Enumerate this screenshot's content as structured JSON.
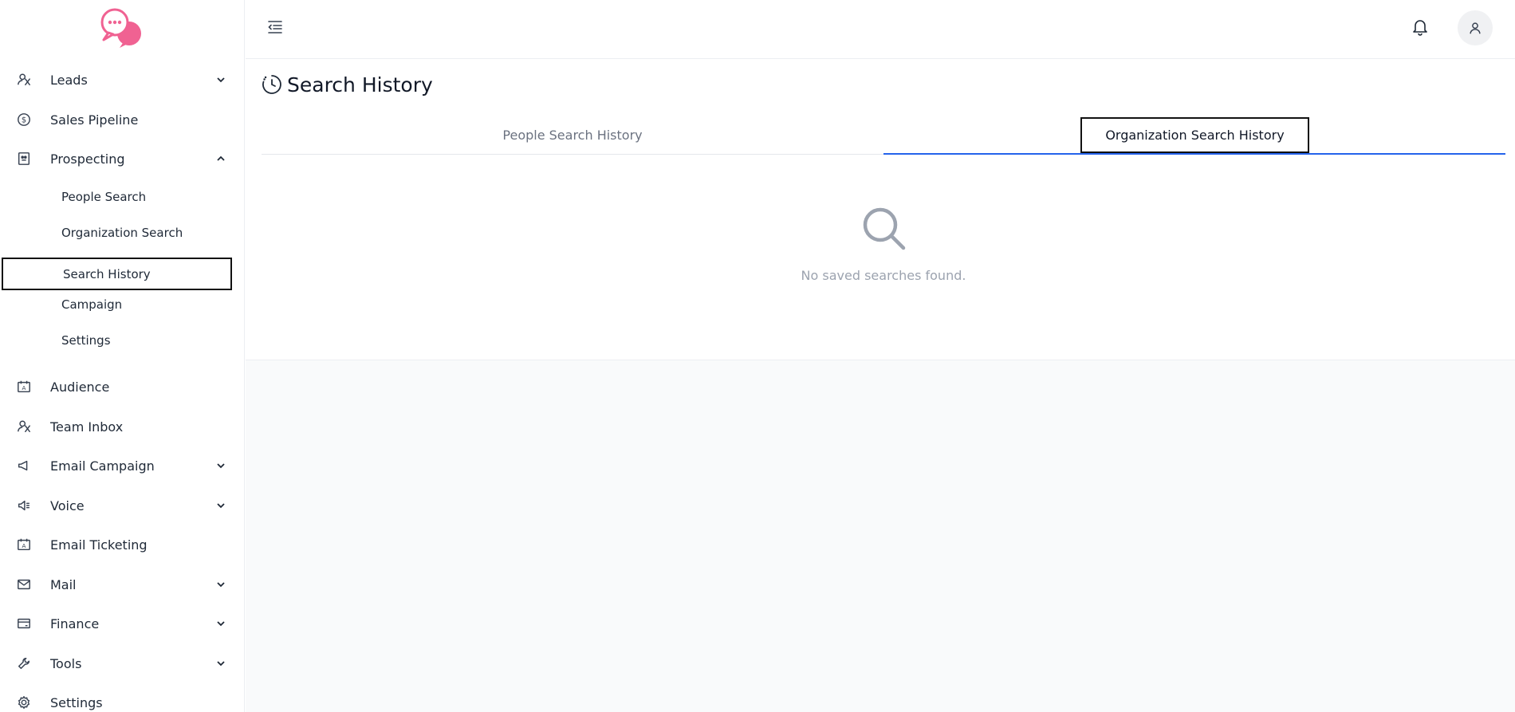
{
  "sidebar": {
    "items": [
      {
        "label": "Leads",
        "icon": "leads-icon",
        "has_chevron": true,
        "chevron": "down"
      },
      {
        "label": "Sales Pipeline",
        "icon": "dollar-icon"
      },
      {
        "label": "Prospecting",
        "icon": "prospecting-icon",
        "has_chevron": true,
        "chevron": "up"
      },
      {
        "label": "Audience",
        "icon": "audience-icon"
      },
      {
        "label": "Team Inbox",
        "icon": "team-inbox-icon"
      },
      {
        "label": "Email Campaign",
        "icon": "megaphone-icon",
        "has_chevron": true,
        "chevron": "down"
      },
      {
        "label": "Voice",
        "icon": "speaker-icon",
        "has_chevron": true,
        "chevron": "down"
      },
      {
        "label": "Email Ticketing",
        "icon": "ticket-icon"
      },
      {
        "label": "Mail",
        "icon": "mail-icon",
        "has_chevron": true,
        "chevron": "down"
      },
      {
        "label": "Finance",
        "icon": "card-icon",
        "has_chevron": true,
        "chevron": "down"
      },
      {
        "label": "Tools",
        "icon": "wrench-icon",
        "has_chevron": true,
        "chevron": "down"
      },
      {
        "label": "Settings",
        "icon": "gear-icon"
      }
    ],
    "prospecting_sub": [
      {
        "label": "People Search"
      },
      {
        "label": "Organization Search"
      },
      {
        "label": "Search History",
        "active": true
      },
      {
        "label": "Campaign"
      },
      {
        "label": "Settings"
      }
    ]
  },
  "main": {
    "title": "Search History",
    "tabs": [
      {
        "label": "People Search History",
        "active": false
      },
      {
        "label": "Organization Search History",
        "active": true
      }
    ],
    "empty_state": "No saved searches found."
  },
  "colors": {
    "accent": "#2563eb",
    "logo_pink": "#f06292",
    "muted": "#9ca3af"
  }
}
